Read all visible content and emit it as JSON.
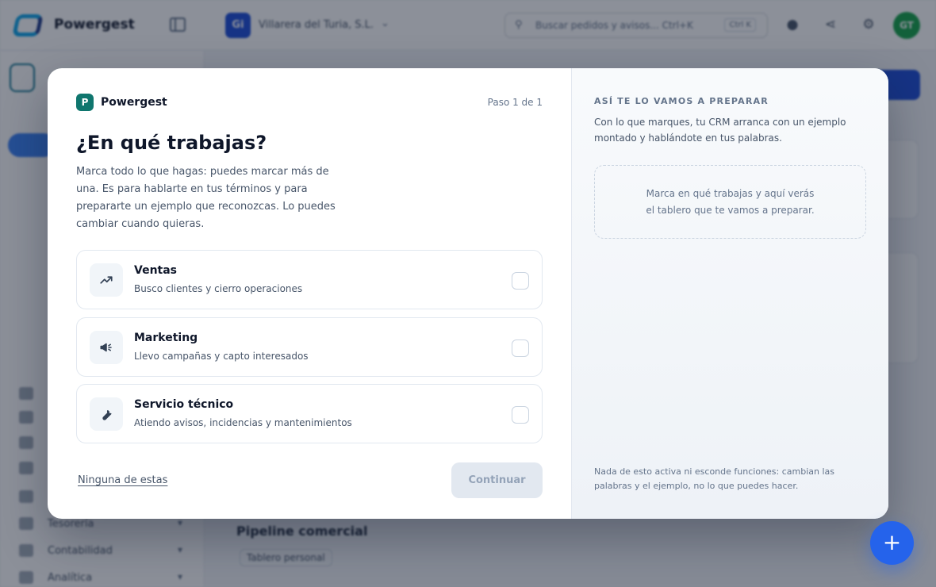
{
  "app": {
    "brand": "Powergest",
    "company_initials": "Gi",
    "company_name": "Villarera del Turia, S.L.",
    "search_placeholder": "Buscar pedidos y avisos... Ctrl+K",
    "search_shortcut": "Ctrl K",
    "user_initials": "GT",
    "sidebar": [
      {
        "label": "",
        "top": 0
      },
      {
        "label": "Tesorería"
      },
      {
        "label": "Contabilidad"
      },
      {
        "label": "Analítica"
      }
    ],
    "pipeline_title": "Pipeline comercial",
    "tablero_label": "Tablero personal"
  },
  "modal": {
    "logo_letter": "P",
    "brand": "Powergest",
    "step": "Paso 1 de 1",
    "title": "¿En qué trabajas?",
    "subtitle": "Marca todo lo que hagas: puedes marcar más de una. Es para hablarte en tus términos y para prepararte un ejemplo que reconozcas. Lo puedes cambiar cuando quieras.",
    "options": [
      {
        "title": "Ventas",
        "desc": "Busco clientes y cierro operaciones",
        "icon": "trending-up-icon",
        "checked": false
      },
      {
        "title": "Marketing",
        "desc": "Llevo campañas y capto interesados",
        "icon": "megaphone-icon",
        "checked": false
      },
      {
        "title": "Servicio técnico",
        "desc": "Atiendo avisos, incidencias y mantenimientos",
        "icon": "wrench-icon",
        "checked": false
      }
    ],
    "none_link": "Ninguna de estas",
    "continue_label": "Continuar"
  },
  "preview": {
    "kicker": "ASÍ TE LO VAMOS A PREPARAR",
    "text": "Con lo que marques, tu CRM arranca con un ejemplo montado y hablándote en tus palabras.",
    "empty_line1": "Marca en qué trabajas y aquí verás",
    "empty_line2": "el tablero que te vamos a preparar.",
    "note": "Nada de esto activa ni esconde funciones: cambian las palabras y el ejemplo, no lo que puedes hacer."
  },
  "fab_symbol": "+",
  "colors": {
    "accent": "#2563eb",
    "brand_teal": "#0f766e",
    "scrim": "#0f172a"
  }
}
